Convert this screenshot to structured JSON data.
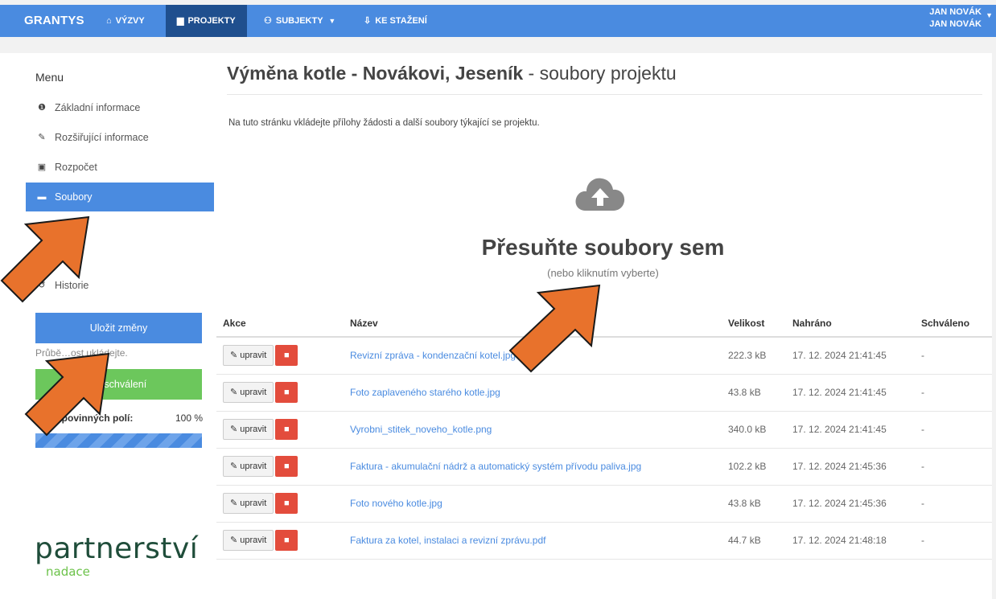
{
  "header": {
    "brand": "GRANTYS",
    "nav": [
      {
        "label": "VÝZVY",
        "icon": "megaphone-icon",
        "glyph": "⌂"
      },
      {
        "label": "PROJEKTY",
        "icon": "document-icon",
        "glyph": "▆"
      },
      {
        "label": "SUBJEKTY",
        "icon": "users-icon",
        "glyph": "⚇"
      },
      {
        "label": "KE STAŽENÍ",
        "icon": "download-icon",
        "glyph": "⇩"
      }
    ],
    "user_line1": "JAN NOVÁK",
    "user_line2": "JAN NOVÁK"
  },
  "sidebar": {
    "title": "Menu",
    "items": [
      {
        "label": "Základní informace",
        "icon": "info-icon",
        "glyph": "❶"
      },
      {
        "label": "Rozšiřující informace",
        "icon": "edit-icon",
        "glyph": "✎"
      },
      {
        "label": "Rozpočet",
        "icon": "money-icon",
        "glyph": "▣"
      },
      {
        "label": "Soubory",
        "icon": "folder-icon",
        "glyph": "▬"
      },
      {
        "label": "…y",
        "icon": "table-icon",
        "glyph": "▤"
      },
      {
        "label": "…sti",
        "icon": "list-icon",
        "glyph": "☰"
      },
      {
        "label": "Historie",
        "icon": "history-icon",
        "glyph": "↺"
      }
    ],
    "save_label": "Uložit změny",
    "hint": "Průbě…ost ukládejte.",
    "submit_label": "ke schválení",
    "required_label": "…ení povinných polí:",
    "required_value": "100 %",
    "required_progress": 1.0
  },
  "logo": {
    "main": "partnerství",
    "sub": "nadace"
  },
  "main": {
    "title_bold": "Výměna kotle - Novákovi, Jeseník",
    "title_rest": " - soubory projektu",
    "intro": "Na tuto stránku vkládejte přílohy žádosti a další soubory týkající se projektu.",
    "drop_title": "Přesuňte soubory sem",
    "drop_sub": "(nebo kliknutím vyberte)",
    "table": {
      "headers": [
        "Akce",
        "Název",
        "Velikost",
        "Nahráno",
        "Schváleno"
      ],
      "edit_label": "upravit",
      "rows": [
        {
          "name": "Revizní zpráva - kondenzační kotel.jpg",
          "size": "222.3 kB",
          "uploaded": "17. 12. 2024 21:41:45",
          "approved": "-"
        },
        {
          "name": "Foto zaplaveného starého kotle.jpg",
          "size": "43.8 kB",
          "uploaded": "17. 12. 2024 21:41:45",
          "approved": "-"
        },
        {
          "name": "Vyrobni_stitek_noveho_kotle.png",
          "size": "340.0 kB",
          "uploaded": "17. 12. 2024 21:41:45",
          "approved": "-"
        },
        {
          "name": "Faktura - akumulační nádrž a automatický systém přívodu paliva.jpg",
          "size": "102.2 kB",
          "uploaded": "17. 12. 2024 21:45:36",
          "approved": "-"
        },
        {
          "name": "Foto nového kotle.jpg",
          "size": "43.8 kB",
          "uploaded": "17. 12. 2024 21:45:36",
          "approved": "-"
        },
        {
          "name": "Faktura za kotel, instalaci a revizní zprávu.pdf",
          "size": "44.7 kB",
          "uploaded": "17. 12. 2024 21:48:18",
          "approved": "-"
        }
      ]
    }
  },
  "colors": {
    "accent": "#4a8be0",
    "danger": "#e34c3c",
    "success": "#6cc75c",
    "arrow": "#e8722c"
  }
}
